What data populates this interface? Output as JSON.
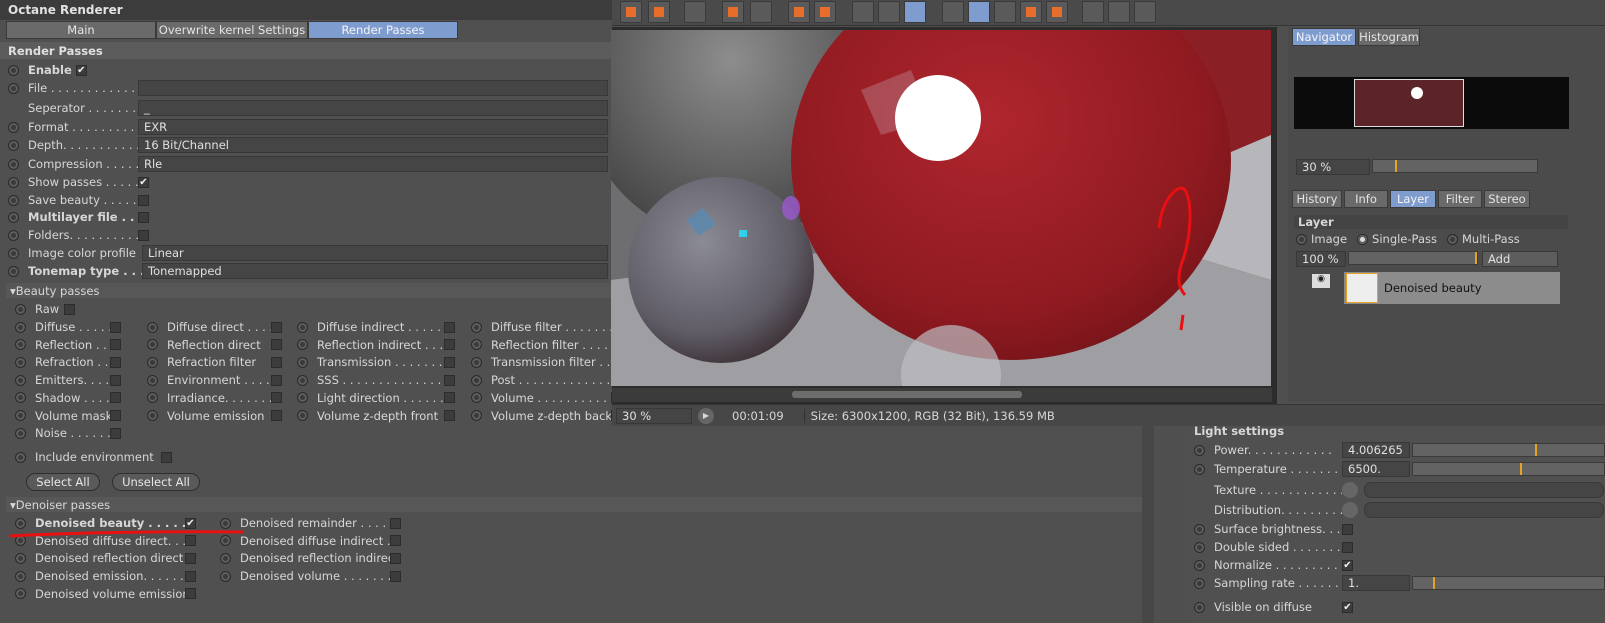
{
  "app": {
    "title": "Octane Renderer"
  },
  "tabs": [
    {
      "label": "Main"
    },
    {
      "label": "Overwrite kernel Settings"
    },
    {
      "label": "Render Passes"
    }
  ],
  "render_passes": {
    "header": "Render Passes",
    "enable": {
      "label": "Enable",
      "checked": true
    },
    "file": {
      "label": "File . . . . . . . . . . . . . . .",
      "value": ""
    },
    "separator": {
      "label": "Seperator . . . . . . . . . .",
      "value": "_"
    },
    "format": {
      "label": "Format . . . . . . . . . . . .",
      "value": "EXR"
    },
    "depth": {
      "label": "Depth. . . . . . . . . . . . . .",
      "value": "16 Bit/Channel"
    },
    "compression": {
      "label": "Compression . . . . . . . .",
      "value": "Rle"
    },
    "show_passes": {
      "label": "Show passes . . . . . .",
      "checked": true
    },
    "save_beauty": {
      "label": "Save beauty . . . . . .",
      "checked": false
    },
    "multilayer": {
      "label": "Multilayer file . .",
      "checked": false
    },
    "folders": {
      "label": "Folders. . . . . . . . . . . .",
      "checked": false
    },
    "color_profile": {
      "label": "Image color profile",
      "value": "Linear"
    },
    "tonemap": {
      "label": "Tonemap type . . .",
      "value": "Tonemapped"
    }
  },
  "beauty": {
    "header": "Beauty passes",
    "raw": "Raw",
    "col1": [
      "Diffuse . . . . . .",
      "Reflection . . . .",
      "Refraction . . . .",
      "Emitters. . . . .",
      "Shadow . . . . . .",
      "Volume mask",
      "Noise . . . . . . ."
    ],
    "col2": [
      "Diffuse direct . . . .",
      "Reflection direct",
      "Refraction filter",
      "Environment . . . .",
      "Irradiance. . . . . . .",
      "Volume emission"
    ],
    "col3": [
      "Diffuse indirect . . . . . .",
      "Reflection indirect . . . .",
      "Transmission . . . . . . . .",
      "SSS . . . . . . . . . . . . . . . .",
      "Light direction . . . . . . .",
      "Volume z-depth front"
    ],
    "col4": [
      "Diffuse filter . . . . . . . . . .",
      "Reflection filter . . . . . . . .",
      "Transmission filter . . . . . .",
      "Post . . . . . . . . . . . . . . . . .",
      "Volume . . . . . . . . . . . . . . .",
      "Volume z-depth back"
    ],
    "include_env": "Include environment",
    "select_all": "Select All",
    "unselect_all": "Unselect All"
  },
  "denoiser": {
    "header": "Denoiser passes",
    "col1": [
      {
        "label": "Denoised beauty . . . . . . .",
        "checked": true
      },
      {
        "label": "Denoised diffuse direct. . .",
        "checked": false
      },
      {
        "label": "Denoised reflection direct",
        "checked": false
      },
      {
        "label": "Denoised emission. . . . . . .",
        "checked": false
      },
      {
        "label": "Denoised volume emission",
        "checked": false
      }
    ],
    "col2": [
      {
        "label": "Denoised remainder . . . . . ."
      },
      {
        "label": "Denoised diffuse indirect . ."
      },
      {
        "label": "Denoised reflection indirect"
      },
      {
        "label": "Denoised volume . . . . . . . . ."
      }
    ]
  },
  "viewer": {
    "zoom": "30 %",
    "time": "00:01:09",
    "info": "Size: 6300x1200, RGB (32 Bit), 136.59 MB",
    "annotation": "?"
  },
  "navigator": {
    "tabs": [
      "Navigator",
      "Histogram"
    ],
    "zoom": "30 %",
    "tabs2": [
      "History",
      "Info",
      "Layer",
      "Filter",
      "Stereo"
    ],
    "layer_title": "Layer",
    "modes": [
      "Image",
      "Single-Pass",
      "Multi-Pass"
    ],
    "opacity": "100 %",
    "add": "Add",
    "layer_name": "Denoised beauty"
  },
  "light": {
    "header": "Light settings",
    "power": {
      "label": "Power. . . . . . . . . . . .",
      "value": "4.006265"
    },
    "temperature": {
      "label": "Temperature . . . . . . .",
      "value": "6500."
    },
    "texture": "Texture . . . . . . . . . . . . .",
    "distribution": "Distribution. . . . . . . . . .",
    "surface": "Surface brightness. . .",
    "double": "Double sided . . . . . . . .",
    "normalize": {
      "label": "Normalize . . . . . . . . . .",
      "checked": true
    },
    "sampling": {
      "label": "Sampling rate . . . . . .",
      "value": "1."
    },
    "visible": "Visible on diffuse"
  },
  "colors": {
    "accent": "#7f9ccf",
    "annotation_red": "#e81010",
    "marker": "#e6a324"
  }
}
